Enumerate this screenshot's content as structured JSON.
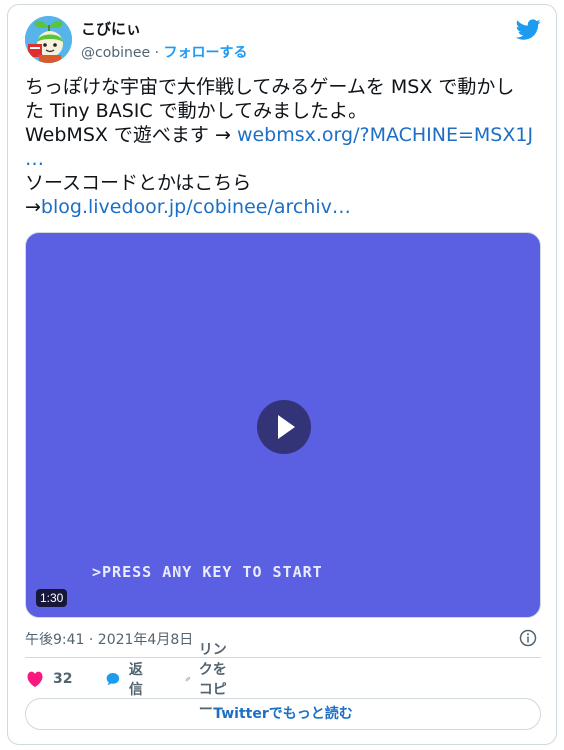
{
  "author": {
    "name": "こびにぃ",
    "handle": "@cobinee",
    "separator": "·",
    "follow_label": "フォローする"
  },
  "tweet": {
    "line1": "ちっぽけな宇宙で大作戦してみるゲームを MSX で動かし",
    "line2": "た Tiny BASIC で動かしてみましたよ。",
    "line3_text": "WebMSX で遊べます → ",
    "line3_link": "webmsx.org/?MACHINE=MSX1J",
    "line4_link": "…",
    "line5": "ソースコードとかはこちら",
    "line6_arrow": "→",
    "line6_link": "blog.livedoor.jp/cobinee/archiv…"
  },
  "media": {
    "screen_text": ">PRESS ANY KEY TO START",
    "duration": "1:30",
    "background_color": "#5b5fe2"
  },
  "timestamp": "午後9:41 · 2021年4月8日",
  "actions": {
    "like_count": "32",
    "reply_label": "返信",
    "copy_link_label": "リンクをコピー"
  },
  "read_more_label": "Twitterでもっと読む",
  "colors": {
    "twitter_blue": "#1d9bf0",
    "link": "#1d6fc4",
    "like_red": "#f91880"
  }
}
